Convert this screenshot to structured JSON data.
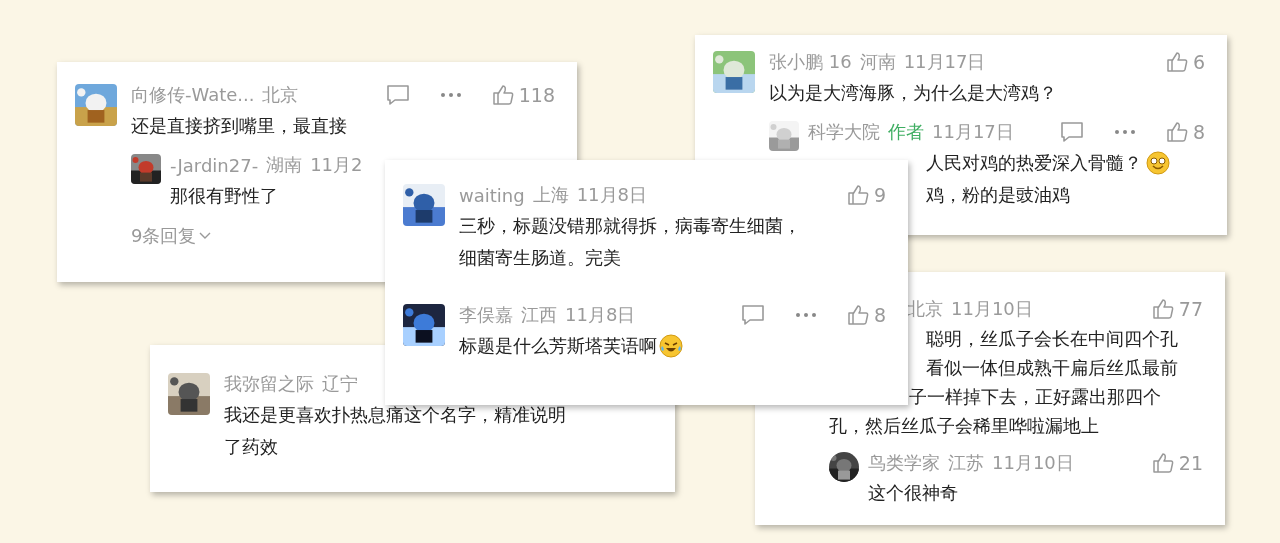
{
  "cards": [
    {
      "comments": [
        {
          "avatar": {
            "kind": "picture"
          },
          "user": "向修传-Wate...",
          "location": "北京",
          "reply_action": true,
          "more_action": true,
          "likes": "118",
          "lines": [
            {
              "text": "还是直接挤到嘴里，最直接"
            }
          ],
          "replies": [
            {
              "avatar": {
                "kind": "picture"
              },
              "user": "-Jardin27-",
              "location": "湖南",
              "date": "11月2",
              "reply_action": false,
              "more_action": false,
              "lines": [
                {
                  "text": "那很有野性了"
                }
              ]
            }
          ],
          "more_replies": "9条回复"
        }
      ]
    },
    {
      "comments": [
        {
          "avatar": {
            "kind": "picture"
          },
          "user": "张小鹏 16",
          "location": "河南",
          "date": "11月17日",
          "reply_action": false,
          "more_action": false,
          "likes": "6",
          "lines": [
            {
              "text": "以为是大湾海豚，为什么是大湾鸡？"
            }
          ],
          "replies": [
            {
              "avatar": {
                "kind": "picture"
              },
              "user": "科学大院",
              "badge": "作者",
              "date": "11月17日",
              "reply_action": true,
              "more_action": true,
              "likes": "8",
              "lines": [
                {
                  "text": "人民对鸡的热爱深入骨髓？",
                  "emoji": {
                    "kind": "smiley"
                  }
                },
                {
                  "text": "鸡，粉的是豉油鸡"
                }
              ]
            }
          ]
        }
      ]
    },
    {
      "comments": [
        {
          "avatar": {
            "kind": "picture"
          },
          "user": "waiting",
          "location": "上海",
          "date": "11月8日",
          "reply_action": false,
          "more_action": false,
          "likes": "9",
          "lines": [
            {
              "text": "三秒，标题没错那就得拆，病毒寄生细菌，"
            },
            {
              "text": "细菌寄生肠道。完美"
            }
          ]
        },
        {
          "avatar": {
            "kind": "picture"
          },
          "user": "李俣嘉",
          "location": "江西",
          "date": "11月8日",
          "reply_action": true,
          "more_action": true,
          "likes": "8",
          "lines": [
            {
              "text": "标题是什么芳斯塔芙语啊",
              "emoji": {
                "kind": "laughing"
              }
            }
          ]
        }
      ]
    },
    {
      "comments": [
        {
          "avatar": {
            "kind": "picture"
          },
          "user": "我弥留之际",
          "location": "辽宁",
          "reply_action": false,
          "more_action": false,
          "lines": [
            {
              "text": "我还是更喜欢扑热息痛这个名字，精准说明"
            },
            {
              "text": "了药效"
            }
          ]
        }
      ]
    },
    {
      "comments": [
        {
          "location": "北京",
          "date": "11月10日",
          "reply_action": false,
          "more_action": false,
          "likes": "77",
          "lines": [
            {
              "text": "聪明，丝瓜子会长在中间四个孔"
            },
            {
              "text": "看似一体但成熟干扁后丝瓜最前"
            },
            {
              "text": "子一样掉下去，正好露出那四个"
            },
            {
              "text": "孔，然后丝瓜子会稀里哗啦漏地上"
            }
          ],
          "replies": [
            {
              "avatar": {
                "kind": "picture"
              },
              "user": "鸟类学家",
              "location": "江苏",
              "date": "11月10日",
              "reply_action": false,
              "more_action": false,
              "likes": "21",
              "lines": [
                {
                  "text": "这个很神奇"
                }
              ]
            }
          ]
        }
      ]
    }
  ]
}
